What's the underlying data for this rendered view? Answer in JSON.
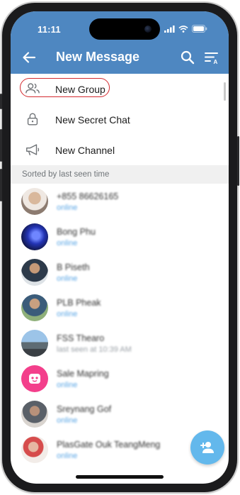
{
  "status_bar": {
    "time": "11:11"
  },
  "app_bar": {
    "title": "New Message"
  },
  "menu": {
    "new_group": "New Group",
    "new_secret_chat": "New Secret Chat",
    "new_channel": "New Channel"
  },
  "section_header": "Sorted by last seen time",
  "contacts": [
    {
      "name": "+855 86626165",
      "status": "online"
    },
    {
      "name": "Bong Phu",
      "status": "online"
    },
    {
      "name": "B Piseth",
      "status": "online"
    },
    {
      "name": "PLB Pheak",
      "status": "online"
    },
    {
      "name": "FSS Thearo",
      "status": "last seen at 10:39 AM"
    },
    {
      "name": "Sale Mapring",
      "status": "online"
    },
    {
      "name": "Sreynang Gof",
      "status": "online"
    },
    {
      "name": "PlasGate Ouk TeangMeng",
      "status": "online"
    }
  ],
  "icons": {
    "back": "arrow-left-icon",
    "search": "search-icon",
    "sort": "sort-icon",
    "new_group": "users-icon",
    "new_secret_chat": "lock-icon",
    "new_channel": "megaphone-icon",
    "fab": "add-contact-icon"
  },
  "colors": {
    "header": "#4e87c1",
    "highlight_ring": "#d32a2f",
    "online": "#5aa6e5",
    "fab": "#63b8ec"
  }
}
